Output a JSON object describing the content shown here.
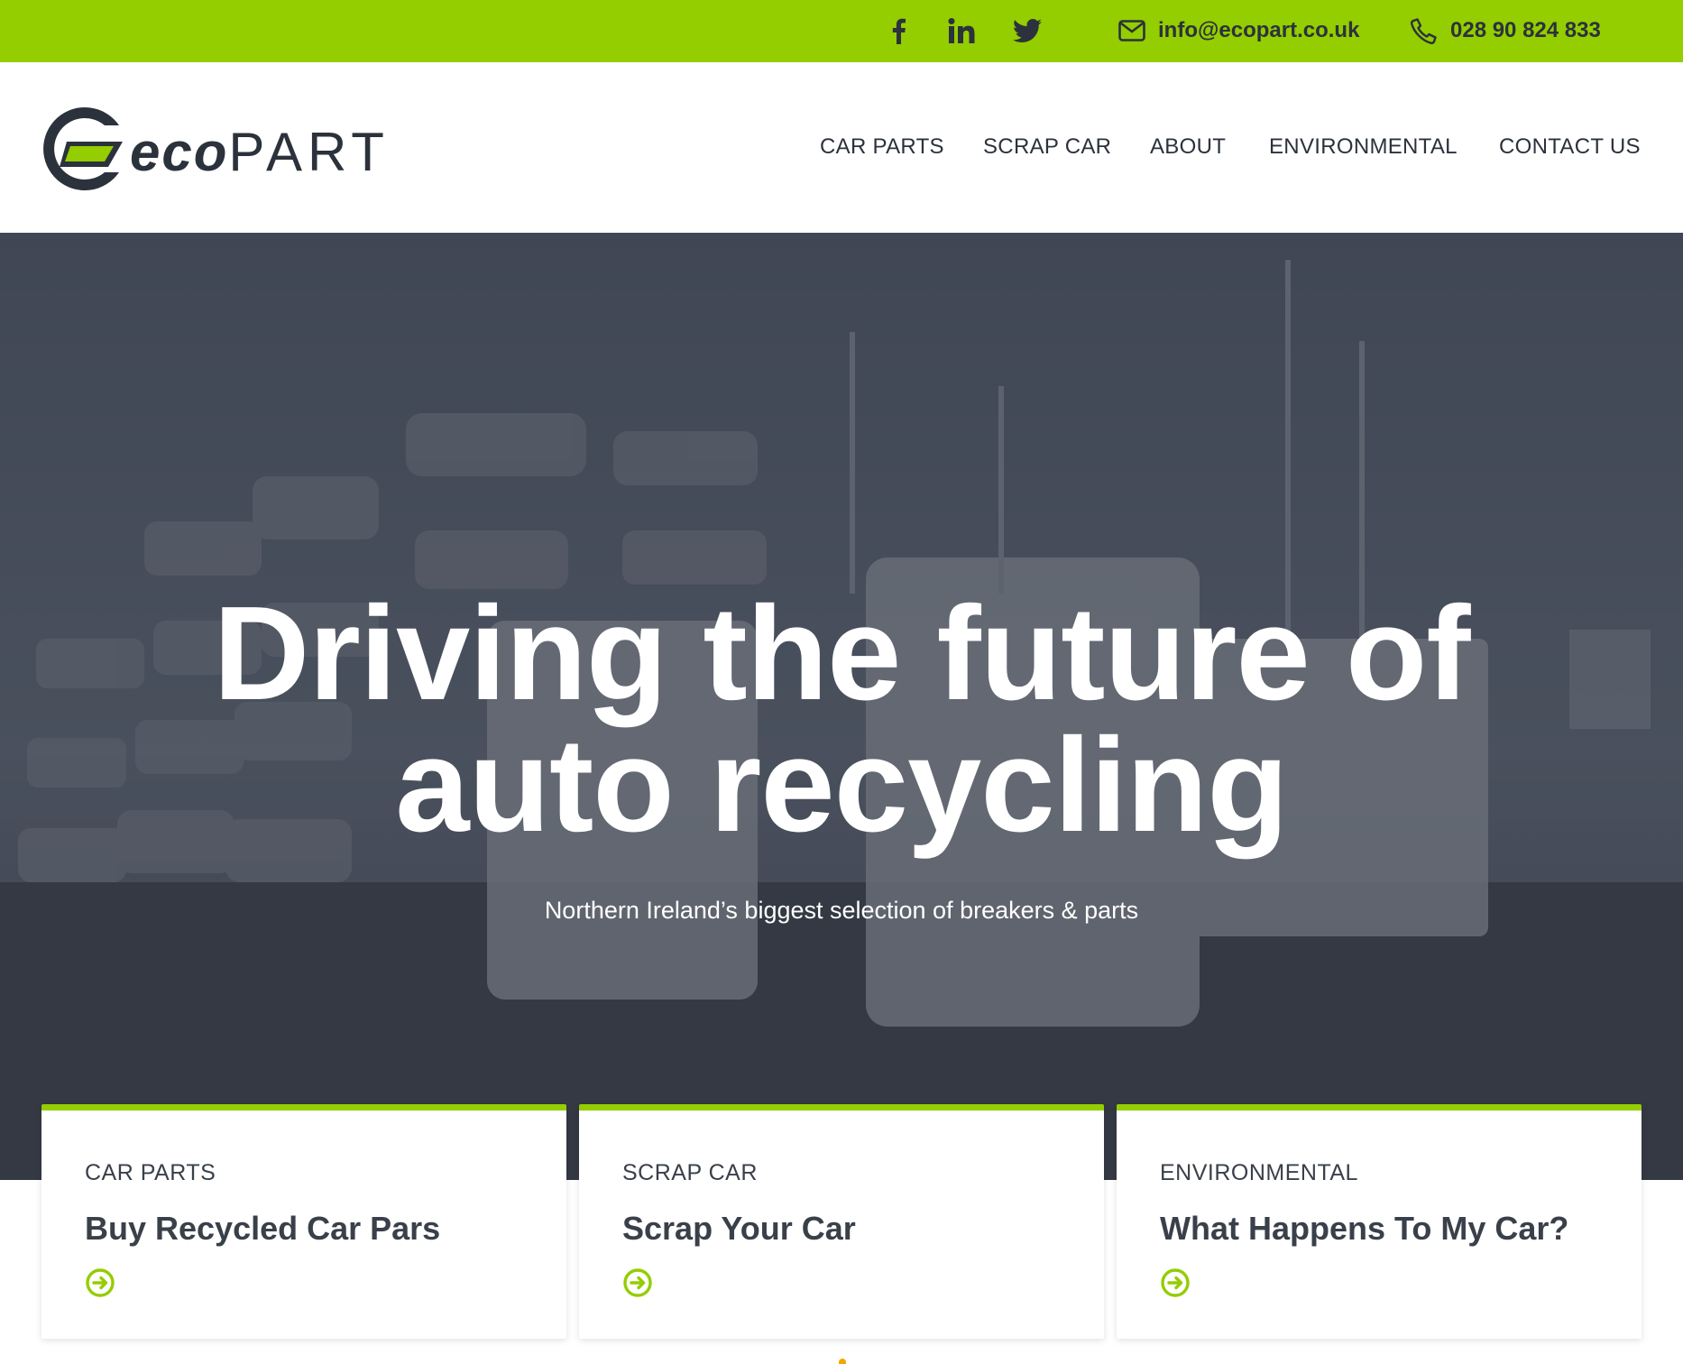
{
  "colors": {
    "brand_green": "#94cd00",
    "dark": "#2b323c"
  },
  "topbar": {
    "social_icons": [
      "facebook-icon",
      "linkedin-icon",
      "twitter-icon"
    ],
    "email": "info@ecopart.co.uk",
    "phone": "028 90 824 833"
  },
  "header": {
    "logo": {
      "eco": "eco",
      "part": "PART"
    },
    "nav": [
      "CAR PARTS",
      "SCRAP CAR",
      "ABOUT",
      "ENVIRONMENTAL",
      "CONTACT US"
    ]
  },
  "hero": {
    "title_line1": "Driving the future of",
    "title_line2": "auto recycling",
    "subtitle": "Northern Ireland’s biggest selection of breakers & parts"
  },
  "cards": [
    {
      "kicker": "CAR PARTS",
      "title": "Buy Recycled Car Pars",
      "icon": "arrow-circle-right-icon"
    },
    {
      "kicker": "SCRAP CAR",
      "title": "Scrap Your Car",
      "icon": "arrow-circle-right-icon"
    },
    {
      "kicker": "ENVIRONMENTAL",
      "title": "What Happens To My Car?",
      "icon": "arrow-circle-right-icon"
    }
  ]
}
